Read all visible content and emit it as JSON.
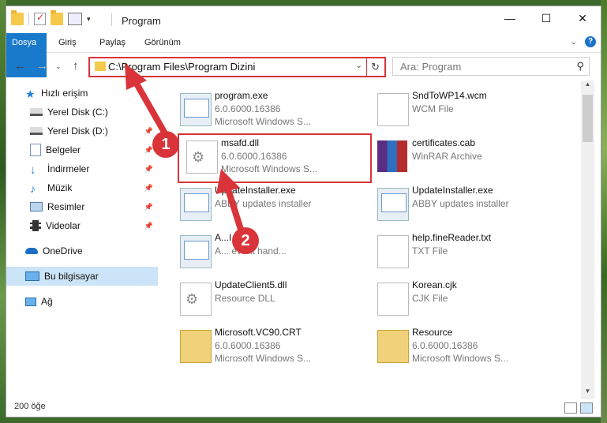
{
  "window": {
    "title": "Program"
  },
  "ribbon": {
    "tabs": [
      "Dosya",
      "Giriş",
      "Paylaş",
      "Görünüm"
    ]
  },
  "address": {
    "path": "C:\\Program Files\\Program Dizini",
    "search_placeholder": "Ara: Program"
  },
  "nav": {
    "items": [
      {
        "label": "Hızlı erişim",
        "icon": "star-icon"
      },
      {
        "label": "Yerel Disk (C:)",
        "icon": "drive-icon"
      },
      {
        "label": "Yerel Disk (D:)",
        "icon": "drive-icon"
      },
      {
        "label": "Belgeler",
        "icon": "documents-icon"
      },
      {
        "label": "İndirmeler",
        "icon": "download-icon"
      },
      {
        "label": "Müzik",
        "icon": "music-icon"
      },
      {
        "label": "Resimler",
        "icon": "pictures-icon"
      },
      {
        "label": "Videolar",
        "icon": "video-icon"
      },
      {
        "label": "OneDrive",
        "icon": "cloud-icon"
      },
      {
        "label": "Bu bilgisayar",
        "icon": "computer-icon"
      },
      {
        "label": "Ağ",
        "icon": "network-icon"
      }
    ]
  },
  "files": [
    {
      "name": "program.exe",
      "line1": "6.0.6000.16386",
      "line2": "Microsoft Windows S...",
      "icon": "exe-icon"
    },
    {
      "name": "SndToWP14.wcm",
      "line1": "WCM File",
      "line2": "",
      "icon": "document-icon"
    },
    {
      "name": "msafd.dll",
      "line1": "6.0.6000.16386",
      "line2": "Microsoft Windows S...",
      "icon": "dll-icon"
    },
    {
      "name": "certificates.cab",
      "line1": "WinRAR Archive",
      "line2": "",
      "icon": "winrar-icon"
    },
    {
      "name": "UpdateInstaller.exe",
      "line1": "ABBY updates installer",
      "line2": "",
      "icon": "exe-icon"
    },
    {
      "name": "UpdateInstaller.exe",
      "line1": "ABBY updates installer",
      "line2": "",
      "icon": "exe-icon"
    },
    {
      "name": "A...I.exe",
      "line1": "A... event hand...",
      "line2": "",
      "icon": "exe-icon"
    },
    {
      "name": "help.fineReader.txt",
      "line1": "TXT File",
      "line2": "",
      "icon": "document-icon"
    },
    {
      "name": "UpdateClient5.dll",
      "line1": "Resource DLL",
      "line2": "",
      "icon": "dll-icon"
    },
    {
      "name": "Korean.cjk",
      "line1": "CJK File",
      "line2": "",
      "icon": "document-icon"
    },
    {
      "name": "Microsoft.VC90.CRT",
      "line1": "6.0.6000.16386",
      "line2": "Microsoft Windows S...",
      "icon": "folder-icon"
    },
    {
      "name": "Resource",
      "line1": "6.0.6000.16386",
      "line2": "Microsoft Windows S...",
      "icon": "folder-icon"
    }
  ],
  "status": {
    "count": "200 öğe"
  },
  "callouts": {
    "one": "1",
    "two": "2"
  },
  "colors": {
    "accent": "#1979ca",
    "highlight": "#d9343a",
    "selected": "#cce4f7"
  }
}
